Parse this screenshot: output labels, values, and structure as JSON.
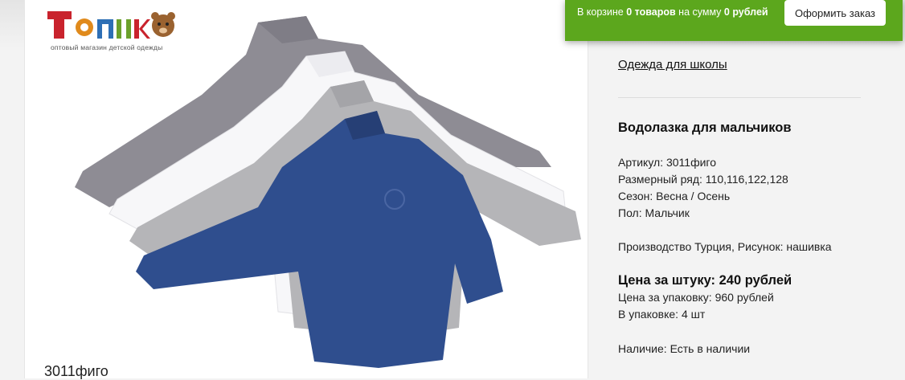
{
  "logo": {
    "name": "ТомикО",
    "tagline": "оптовый магазин детской одежды"
  },
  "product_image": {
    "caption": "3011фиго",
    "colors": [
      "#8e8c94",
      "#f7f7f9",
      "#b5b5b8",
      "#2f4e8e"
    ]
  },
  "breadcrumb": "Одежда для школы",
  "product": {
    "title": "Водолазка для мальчиков",
    "article": "Артикул: 3011фиго",
    "sizes": "Размерный ряд: 110,116,122,128",
    "season": "Сезон: Весна / Осень",
    "gender": "Пол: Мальчик",
    "production": "Производство Турция, Рисунок: нашивка",
    "price_unit": "Цена за штуку: 240 рублей",
    "price_pack": "Цена за упаковку: 960 рублей",
    "pack_qty": "В упаковке: 4 шт",
    "availability": "Наличие: Есть в наличии"
  },
  "cart": {
    "prefix": "В корзине ",
    "count": "0 товаров",
    "middle": " на сумму ",
    "sum": "0 рублей",
    "order_button": "Оформить заказ",
    "bar_color": "#5ca71d"
  }
}
